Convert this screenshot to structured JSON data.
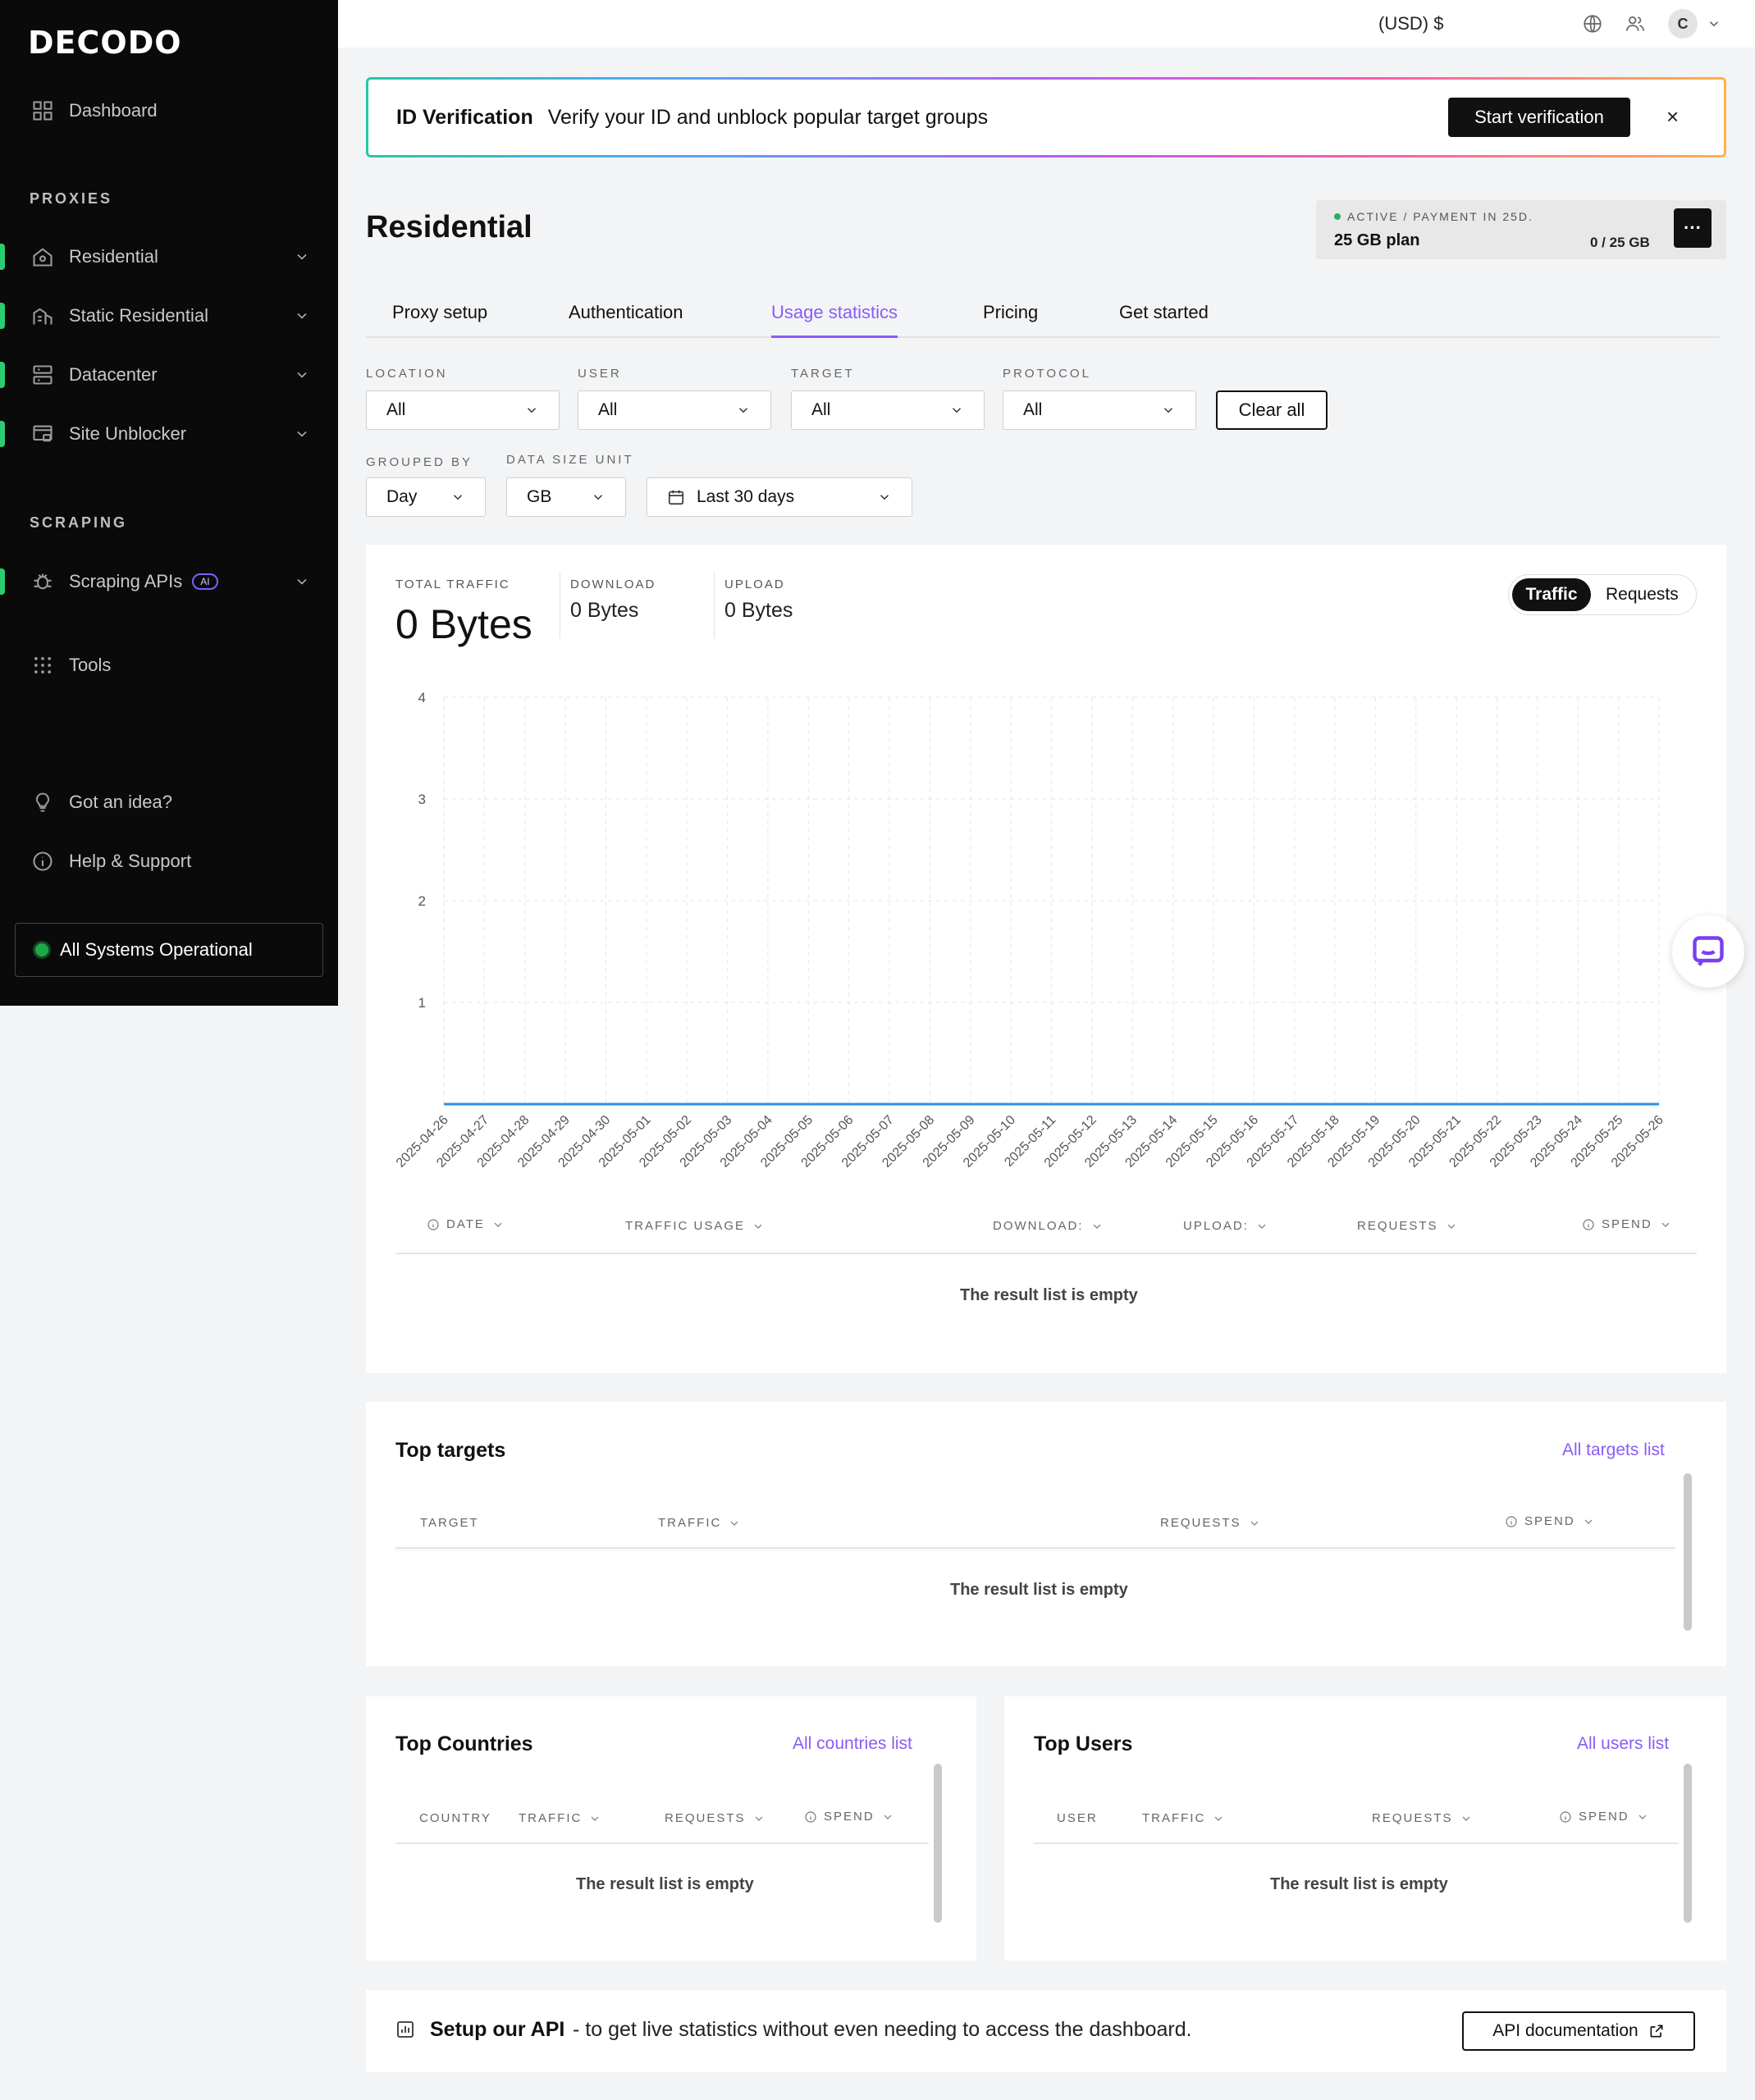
{
  "brand": {
    "logo_text": "DECODO"
  },
  "sidebar": {
    "dashboard": "Dashboard",
    "proxies_label": "PROXIES",
    "proxies": [
      "Residential",
      "Static Residential",
      "Datacenter",
      "Site Unblocker"
    ],
    "scraping_label": "SCRAPING",
    "scraping_apis": "Scraping APIs",
    "ai_badge": "AI",
    "tools": "Tools",
    "idea": "Got an idea?",
    "help": "Help & Support",
    "status": "All Systems Operational"
  },
  "topbar": {
    "currency": "(USD) $",
    "avatar_initial": "C"
  },
  "banner": {
    "title": "ID Verification",
    "text": "Verify your ID and unblock popular target groups",
    "button": "Start verification",
    "close": "×"
  },
  "header": {
    "title": "Residential",
    "plan_status": "ACTIVE / PAYMENT IN 25D.",
    "plan_name": "25 GB plan",
    "plan_usage": "0 / 25 GB",
    "more": "···"
  },
  "tabs": [
    "Proxy setup",
    "Authentication",
    "Usage statistics",
    "Pricing",
    "Get started"
  ],
  "active_tab": "Usage statistics",
  "filters": {
    "location_label": "LOCATION",
    "location": "All",
    "user_label": "USER",
    "user": "All",
    "target_label": "TARGET",
    "target": "All",
    "protocol_label": "PROTOCOL",
    "protocol": "All",
    "clear": "Clear all",
    "grouped_label": "GROUPED BY",
    "grouped": "Day",
    "unit_label": "DATA SIZE UNIT",
    "unit": "GB",
    "range": "Last 30 days"
  },
  "stats": {
    "total_label": "TOTAL TRAFFIC",
    "total": "0 Bytes",
    "download_label": "DOWNLOAD",
    "download": "0 Bytes",
    "upload_label": "UPLOAD",
    "upload": "0 Bytes",
    "toggle_on": "Traffic",
    "toggle_off": "Requests"
  },
  "chart_data": {
    "type": "line",
    "x": [
      "2025-04-26",
      "2025-04-27",
      "2025-04-28",
      "2025-04-29",
      "2025-04-30",
      "2025-05-01",
      "2025-05-02",
      "2025-05-03",
      "2025-05-04",
      "2025-05-05",
      "2025-05-06",
      "2025-05-07",
      "2025-05-08",
      "2025-05-09",
      "2025-05-10",
      "2025-05-11",
      "2025-05-12",
      "2025-05-13",
      "2025-05-14",
      "2025-05-15",
      "2025-05-16",
      "2025-05-17",
      "2025-05-18",
      "2025-05-19",
      "2025-05-20",
      "2025-05-21",
      "2025-05-22",
      "2025-05-23",
      "2025-05-24",
      "2025-05-25",
      "2025-05-26"
    ],
    "series": [
      {
        "values": [
          0,
          0,
          0,
          0,
          0,
          0,
          0,
          0,
          0,
          0,
          0,
          0,
          0,
          0,
          0,
          0,
          0,
          0,
          0,
          0,
          0,
          0,
          0,
          0,
          0,
          0,
          0,
          0,
          0,
          0,
          0
        ]
      }
    ],
    "yticks": [
      "4",
      "3",
      "2",
      "1"
    ],
    "ylim": [
      0,
      4
    ],
    "grid": true,
    "line_color": "#2f8fe0"
  },
  "usage_table": {
    "headers": [
      "DATE",
      "TRAFFIC USAGE",
      "DOWNLOAD:",
      "UPLOAD:",
      "REQUESTS",
      "SPEND"
    ],
    "empty": "The result list is empty"
  },
  "top_targets": {
    "title": "Top targets",
    "link": "All targets list",
    "headers": [
      "TARGET",
      "TRAFFIC",
      "REQUESTS",
      "SPEND"
    ],
    "empty": "The result list is empty"
  },
  "top_countries": {
    "title": "Top Countries",
    "link": "All countries list",
    "headers": [
      "COUNTRY",
      "TRAFFIC",
      "REQUESTS",
      "SPEND"
    ],
    "empty": "The result list is empty"
  },
  "top_users": {
    "title": "Top Users",
    "link": "All users list",
    "headers": [
      "USER",
      "TRAFFIC",
      "REQUESTS",
      "SPEND"
    ],
    "empty": "The result list is empty"
  },
  "api_banner": {
    "title": "Setup our API",
    "text": "- to get live statistics without even needing to access the dashboard.",
    "button": "API documentation"
  }
}
